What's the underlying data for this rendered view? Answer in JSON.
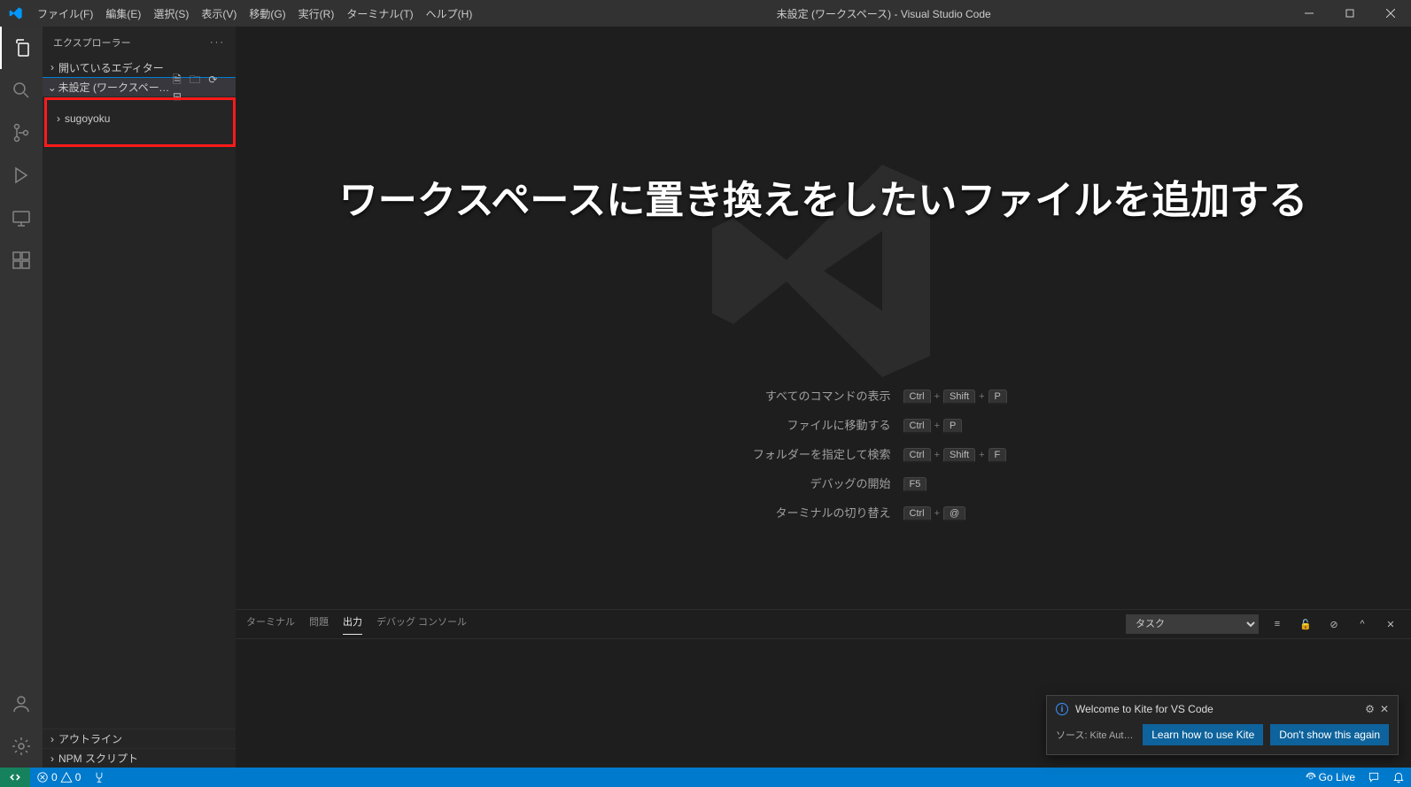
{
  "titlebar": {
    "title": "未設定 (ワークスペース) - Visual Studio Code",
    "menu": [
      "ファイル(F)",
      "編集(E)",
      "選択(S)",
      "表示(V)",
      "移動(G)",
      "実行(R)",
      "ターミナル(T)",
      "ヘルプ(H)"
    ]
  },
  "sidebar": {
    "title": "エクスプローラー",
    "open_editors": "開いているエディター",
    "workspace_label": "未設定 (ワークスペース)",
    "folder": "sugoyoku",
    "outline": "アウトライン",
    "npm": "NPM スクリプト"
  },
  "overlay_text": "ワークスペースに置き換えをしたいファイルを追加する",
  "hints": [
    {
      "label": "すべてのコマンドの表示",
      "keys": [
        "Ctrl",
        "Shift",
        "P"
      ]
    },
    {
      "label": "ファイルに移動する",
      "keys": [
        "Ctrl",
        "P"
      ]
    },
    {
      "label": "フォルダーを指定して検索",
      "keys": [
        "Ctrl",
        "Shift",
        "F"
      ]
    },
    {
      "label": "デバッグの開始",
      "keys": [
        "F5"
      ]
    },
    {
      "label": "ターミナルの切り替え",
      "keys": [
        "Ctrl",
        "@"
      ]
    }
  ],
  "panel": {
    "tabs": [
      "ターミナル",
      "問題",
      "出力",
      "デバッグ コンソール"
    ],
    "active_tab_index": 2,
    "dropdown": "タスク"
  },
  "notification": {
    "title": "Welcome to Kite for VS Code",
    "source": "ソース: Kite Autocomplete f...",
    "btn1": "Learn how to use Kite",
    "btn2": "Don't show this again"
  },
  "statusbar": {
    "errors": "0",
    "warnings": "0",
    "golive": "Go Live"
  }
}
